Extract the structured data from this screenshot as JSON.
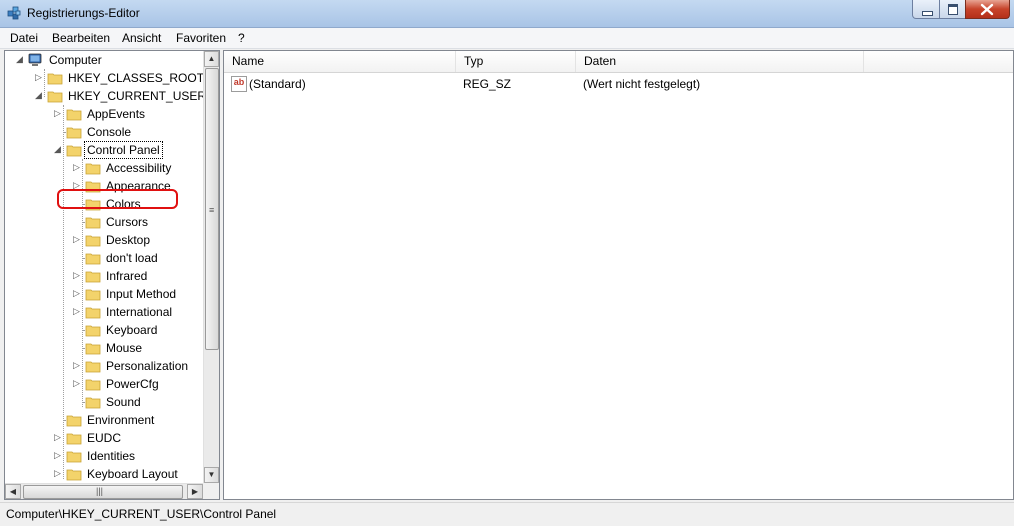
{
  "window": {
    "title": "Registrierungs-Editor",
    "app_icon": "regedit-icon",
    "accent_close": "#c7432a"
  },
  "menu": [
    {
      "label": "Datei"
    },
    {
      "label": "Bearbeiten"
    },
    {
      "label": "Ansicht"
    },
    {
      "label": "Favoriten"
    },
    {
      "label": "?"
    }
  ],
  "tree": {
    "root": "Computer",
    "hkcr": "HKEY_CLASSES_ROOT",
    "hkcu": "HKEY_CURRENT_USER",
    "hkcu_children": [
      "AppEvents",
      "Console",
      "Control Panel",
      "Environment",
      "EUDC",
      "Identities",
      "Keyboard Layout"
    ],
    "control_panel_children": [
      "Accessibility",
      "Appearance",
      "Colors",
      "Cursors",
      "Desktop",
      "don't load",
      "Infrared",
      "Input Method",
      "International",
      "Keyboard",
      "Mouse",
      "Personalization",
      "PowerCfg",
      "Sound"
    ]
  },
  "list": {
    "columns": [
      "Name",
      "Typ",
      "Daten"
    ],
    "rows": [
      {
        "name": "(Standard)",
        "type": "REG_SZ",
        "data": "(Wert nicht festgelegt)",
        "icon": "string-value-icon"
      }
    ]
  },
  "status": {
    "path": "Computer\\HKEY_CURRENT_USER\\Control Panel"
  }
}
